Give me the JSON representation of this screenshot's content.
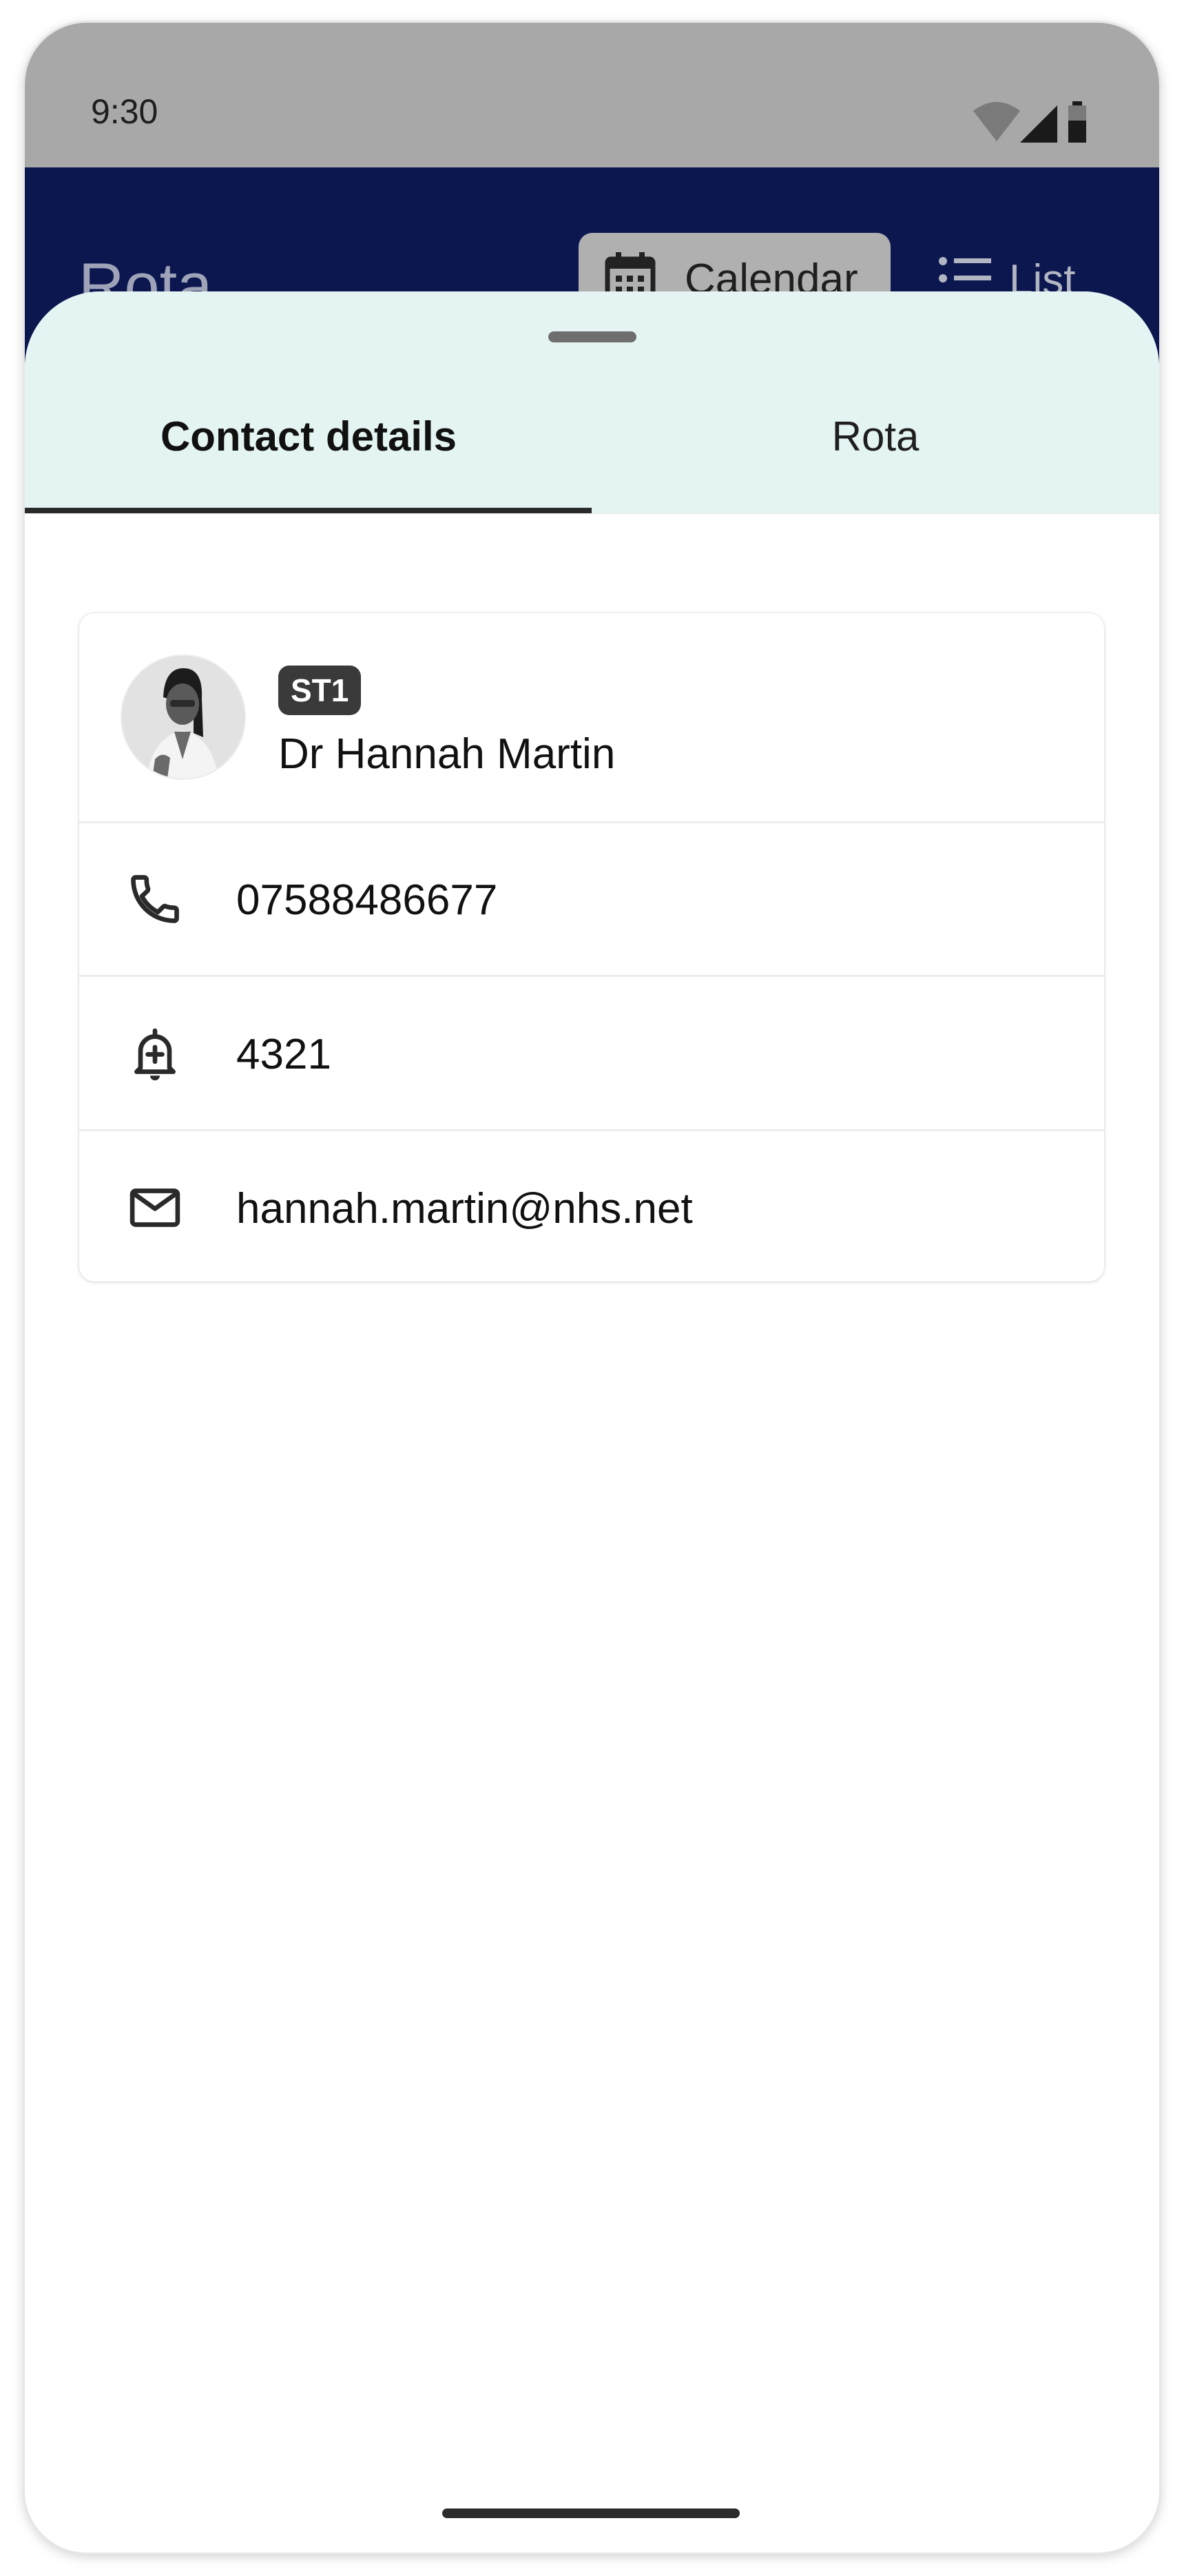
{
  "status_bar": {
    "time": "9:30"
  },
  "app_bar": {
    "title": "Rota",
    "views": [
      {
        "label": "Calendar",
        "icon": "calendar-icon",
        "selected": true
      },
      {
        "label": "List",
        "icon": "list-icon",
        "selected": false
      }
    ]
  },
  "sheet": {
    "tabs": [
      {
        "label": "Contact details",
        "active": true
      },
      {
        "label": "Rota",
        "active": false
      }
    ]
  },
  "contact": {
    "grade": "ST1",
    "name": "Dr Hannah Martin",
    "phone": "07588486677",
    "bleep": "4321",
    "email": "hannah.martin@nhs.net"
  },
  "colors": {
    "app_bar": "#0c1750",
    "sheet_header": "#e4f4f3",
    "status_bar": "#a8a8a8",
    "badge": "#3a3a3a"
  }
}
